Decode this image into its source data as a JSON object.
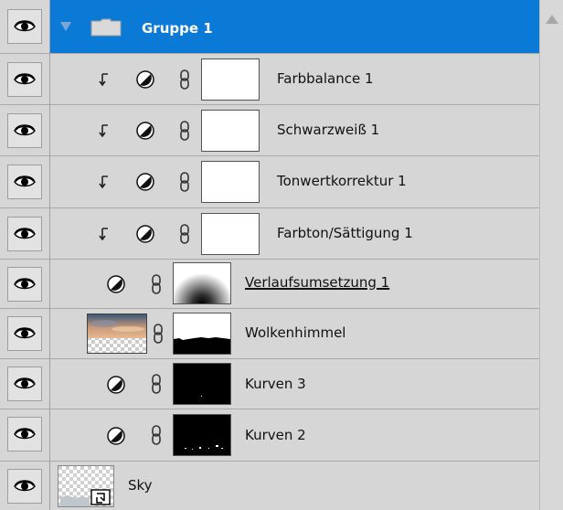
{
  "layers_panel": {
    "group": {
      "name": "Gruppe 1",
      "expanded": true,
      "selected": true
    },
    "layers": [
      {
        "name": "Farbbalance 1",
        "type": "adjustment",
        "clipped": true
      },
      {
        "name": "Schwarzweiß 1",
        "type": "adjustment",
        "clipped": true
      },
      {
        "name": "Tonwertkorrektur 1",
        "type": "adjustment",
        "clipped": true
      },
      {
        "name": "Farbton/Sättigung 1",
        "type": "adjustment",
        "clipped": true
      },
      {
        "name": "Verlaufsumsetzung 1",
        "type": "adjustment",
        "mask": "radial-gradient"
      },
      {
        "name": "Wolkenhimmel",
        "type": "image",
        "mask": "horizon"
      },
      {
        "name": "Kurven 3",
        "type": "adjustment",
        "mask": "black"
      },
      {
        "name": "Kurven 2",
        "type": "adjustment",
        "mask": "black-specks"
      }
    ],
    "background": {
      "name": "Sky",
      "type": "smart-object"
    }
  },
  "colors": {
    "selection": "#0b7ad6",
    "panel": "#d6d6d6"
  }
}
